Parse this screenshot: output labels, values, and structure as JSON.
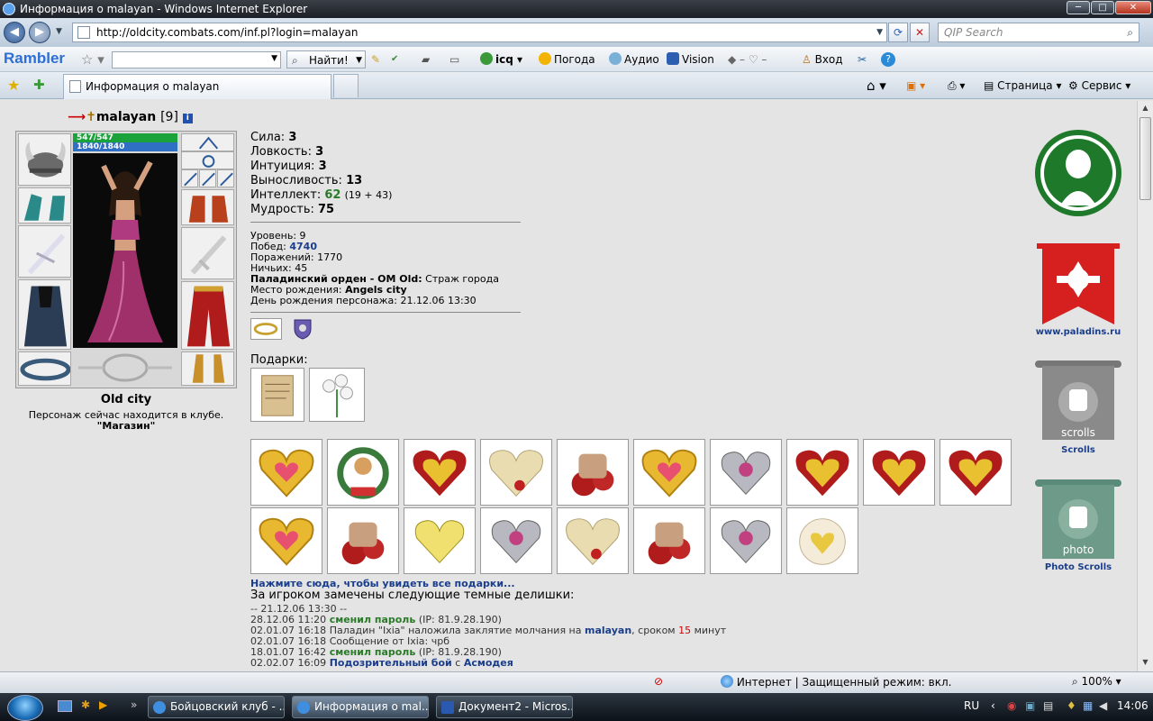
{
  "window": {
    "title": "Информация о malayan - Windows Internet Explorer",
    "min": "─",
    "max": "□",
    "close": "✕"
  },
  "address": {
    "url": "http://oldcity.combats.com/inf.pl?login=malayan",
    "search_placeholder": "QIP Search"
  },
  "rambler": {
    "logo": "Rambler",
    "find": "Найти!",
    "icq": "icq",
    "weather": "Погода",
    "audio": "Аудио",
    "vision": "Vision",
    "login": "Вход"
  },
  "tabs": {
    "active": "Информация о malayan",
    "page": "Страница",
    "service": "Сервис"
  },
  "character": {
    "name": "malayan",
    "level": "[9]",
    "hp": "547/547",
    "mana": "1840/1840",
    "city": "Old city",
    "location_line1": "Персонаж сейчас находится в клубе.",
    "location_line2": "\"Магазин\""
  },
  "stats": {
    "strength_label": "Сила:",
    "strength": "3",
    "agility_label": "Ловкость:",
    "agility": "3",
    "intuition_label": "Интуиция:",
    "intuition": "3",
    "endurance_label": "Выносливость:",
    "endurance": "13",
    "intellect_label": "Интеллект:",
    "intellect": "62",
    "intellect_detail": "(19 + 43)",
    "wisdom_label": "Мудрость:",
    "wisdom": "75"
  },
  "info": {
    "level_label": "Уровень:",
    "level": "9",
    "wins_label": "Побед:",
    "wins": "4740",
    "losses_label": "Поражений:",
    "losses": "1770",
    "draws_label": "Ничьих:",
    "draws": "45",
    "order": "Паладинский орден - ОМ Old:",
    "order_rank": "Страж города",
    "birthplace_label": "Место рождения:",
    "birthplace": "Angels city",
    "birthday_label": "День рождения персонажа:",
    "birthday": "21.12.06 13:30"
  },
  "gifts": {
    "label": "Подарки:",
    "show_all": "Нажмите сюда, чтобы увидеть все подарки...",
    "dark_deeds": "За игроком замечены следующие темные делишки:"
  },
  "log": {
    "r0": "-- 21.12.06 13:30 --",
    "r1_time": "28.12.06 11:20",
    "r1_action": "сменил пароль",
    "r1_ip": "(IP: 81.9.28.190)",
    "r2_time": "02.01.07 16:18",
    "r2_text": "Паладин \"Ixia\" наложила заклятие молчания на",
    "r2_user": "malayan",
    "r2_term": ", сроком",
    "r2_num": "15",
    "r2_unit": "минут",
    "r3_time": "02.01.07 16:18",
    "r3_text": "Сообщение от Ixia: чрб",
    "r4_time": "18.01.07 16:42",
    "r4_action": "сменил пароль",
    "r4_ip": "(IP: 81.9.28.190)",
    "r5_time": "02.02.07 16:09",
    "r5_action": "Подозрительный бой",
    "r5_with": "с",
    "r5_user": "Асмодея"
  },
  "right": {
    "paladins": "www.paladins.ru",
    "scrolls_text": "scrolls",
    "scrolls": "Scrolls",
    "photo_text": "photo",
    "photo": "Photo Scrolls"
  },
  "status": {
    "zone": "Интернет | Защищенный режим: вкл.",
    "zoom": "100%"
  },
  "taskbar": {
    "t1": "Бойцовский клуб - ...",
    "t2": "Информация о mal...",
    "t3": "Документ2 - Micros...",
    "lang": "RU",
    "clock": "14:06"
  },
  "colors": {
    "hp": "#1aa33a",
    "mana": "#2f6fc4",
    "link": "#1a3e8c",
    "green_link": "#2a7a2a",
    "paladin_red": "#d62020",
    "paladin_green": "#1e7a2a"
  }
}
